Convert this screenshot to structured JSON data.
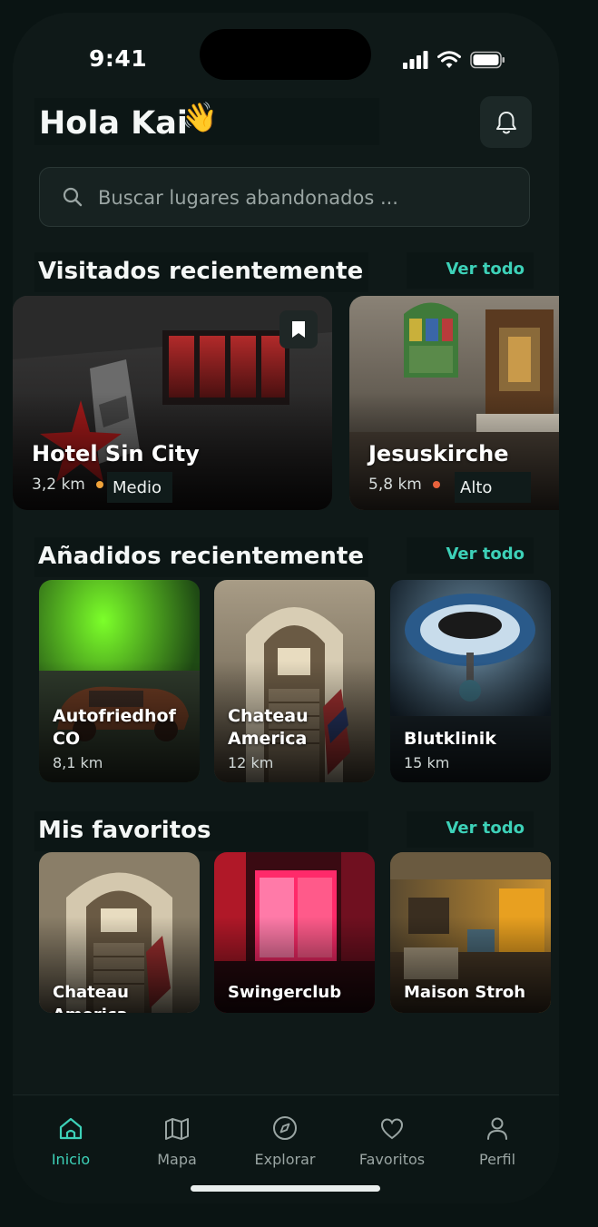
{
  "status": {
    "time": "9:41"
  },
  "greeting": {
    "text": "Hola Kai",
    "emoji": "👋"
  },
  "search": {
    "placeholder": "Buscar lugares abandonados ..."
  },
  "recently_visited": {
    "title": "Visitados recientemente",
    "see_all": "Ver todo",
    "items": [
      {
        "name": "Hotel Sin City",
        "distance": "3,2 km",
        "level": "Medio",
        "level_color": "#f0a33a"
      },
      {
        "name": "Jesuskirche",
        "distance": "5,8 km",
        "level": "Alto",
        "level_color": "#e8623c"
      }
    ]
  },
  "recently_added": {
    "title": "Añadidos recientemente",
    "see_all": "Ver todo",
    "items": [
      {
        "name": "Autofriedhof CO",
        "distance": "8,1 km"
      },
      {
        "name": "Chateau America",
        "distance": "12 km"
      },
      {
        "name": "Blutklinik",
        "distance": "15 km"
      }
    ]
  },
  "favorites": {
    "title": "Mis favoritos",
    "see_all": "Ver todo",
    "items": [
      {
        "name": "Chateau America"
      },
      {
        "name": "Swingerclub"
      },
      {
        "name": "Maison Stroh"
      }
    ]
  },
  "nav": {
    "items": [
      {
        "label": "Inicio",
        "icon": "home-icon",
        "active": true
      },
      {
        "label": "Mapa",
        "icon": "map-icon",
        "active": false
      },
      {
        "label": "Explorar",
        "icon": "compass-icon",
        "active": false
      },
      {
        "label": "Favoritos",
        "icon": "heart-icon",
        "active": false
      },
      {
        "label": "Perfil",
        "icon": "user-icon",
        "active": false
      }
    ]
  },
  "colors": {
    "accent": "#3dd1b8",
    "background": "#0f1918"
  }
}
